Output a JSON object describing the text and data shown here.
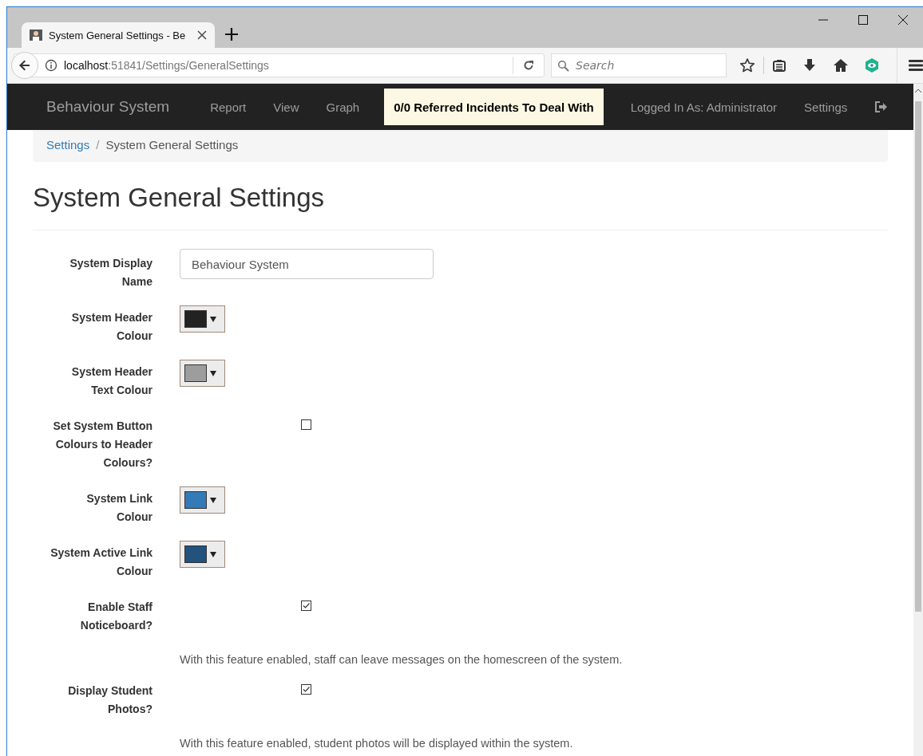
{
  "browser": {
    "tab_title": "System General Settings - Be",
    "url_host": "localhost",
    "url_path": ":51841/Settings/GeneralSettings",
    "search_placeholder": "Search"
  },
  "navbar": {
    "brand": "Behaviour System",
    "links": [
      "Report",
      "View",
      "Graph"
    ],
    "alert": "0/0 Referred Incidents To Deal With",
    "user": "Logged In As: Administrator",
    "settings": "Settings"
  },
  "breadcrumb_separator": "/",
  "breadcrumb": [
    {
      "label": "Settings",
      "kind": "link"
    },
    {
      "label": "System General Settings",
      "kind": "current"
    }
  ],
  "page_title": "System General Settings",
  "form": [
    {
      "kind": "text",
      "label": "System Display Name",
      "value": "Behaviour System"
    },
    {
      "kind": "color",
      "label": "System Header Colour",
      "color": "#222222"
    },
    {
      "kind": "color",
      "label": "System Header Text Colour",
      "color": "#9d9d9d"
    },
    {
      "kind": "checkbox",
      "label": "Set System Button Colours to Header Colours?",
      "checked": false
    },
    {
      "kind": "color",
      "label": "System Link Colour",
      "color": "#337ab7"
    },
    {
      "kind": "color",
      "label": "System Active Link Colour",
      "color": "#23527c"
    },
    {
      "kind": "checkbox",
      "label": "Enable Staff Noticeboard?",
      "checked": true,
      "help": "With this feature enabled, staff can leave messages on the homescreen of the system."
    },
    {
      "kind": "checkbox",
      "label": "Display Student Photos?",
      "checked": true,
      "help": "With this feature enabled, student photos will be displayed within the system."
    }
  ]
}
